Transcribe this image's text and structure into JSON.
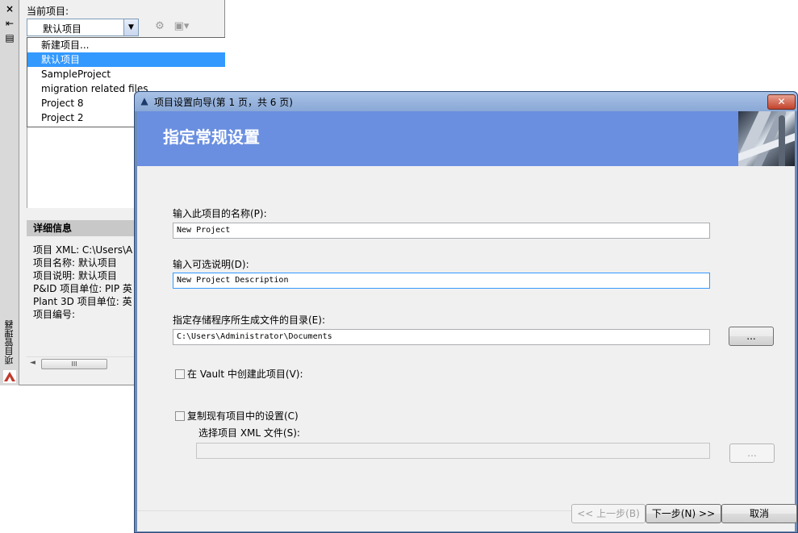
{
  "project_manager": {
    "title": "项目管理器",
    "current_project_label": "当前项目:",
    "combo_value": "默认项目",
    "dropdown_items": [
      {
        "label": "新建项目...",
        "selected": false
      },
      {
        "label": "默认项目",
        "selected": true
      },
      {
        "label": "SampleProject",
        "selected": false
      },
      {
        "label": "migration related files",
        "selected": false
      },
      {
        "label": "Project 8",
        "selected": false
      },
      {
        "label": "Project 2",
        "selected": false
      }
    ],
    "details_header": "详细信息",
    "details": [
      "项目 XML: C:\\Users\\A",
      "项目名称: 默认项目",
      "项目说明: 默认项目",
      "P&ID 项目单位: PIP 英",
      "Plant 3D 项目单位: 英",
      "项目编号:"
    ],
    "strip_icons": {
      "close": "×",
      "pin": "⇤",
      "menu": "▤"
    },
    "scroll_thumb_grip": "III"
  },
  "wizard": {
    "title": "项目设置向导(第 1 页，共 6 页)",
    "close_glyph": "✕",
    "banner_title": "指定常规设置",
    "name_label": "输入此项目的名称(P):",
    "name_value": "New Project",
    "desc_label": "输入可选说明(D):",
    "desc_value": "New Project Description",
    "dir_label": "指定存储程序所生成文件的目录(E):",
    "dir_value": "C:\\Users\\Administrator\\Documents",
    "browse_label": "...",
    "vault_label": "在 Vault 中创建此项目(V):",
    "vault_checked": false,
    "copy_label": "复制现有项目中的设置(C)",
    "copy_checked": false,
    "xml_label": "选择项目 XML 文件(S):",
    "xml_value": "",
    "xml_browse_label": "...",
    "back_label": "<< 上一步(B)",
    "next_label": "下一步(N) >>",
    "cancel_label": "取消"
  },
  "colors": {
    "banner": "#6a8fe0",
    "selection": "#3399ff",
    "close_button": "#c2432c"
  }
}
